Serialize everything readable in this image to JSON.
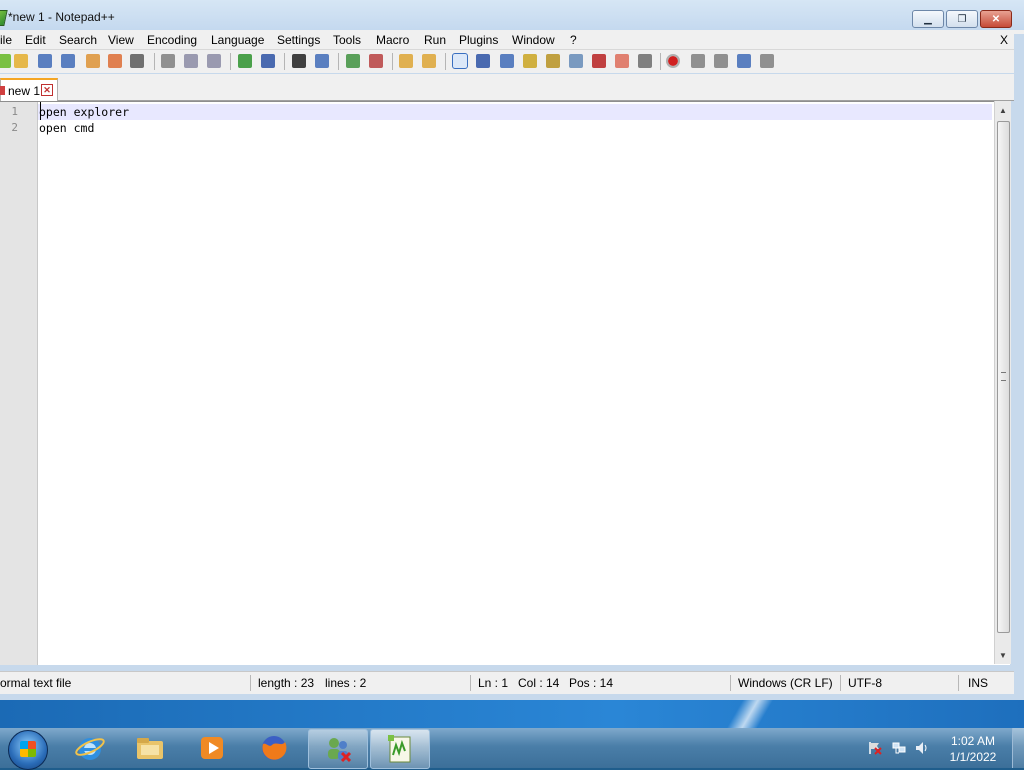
{
  "window": {
    "title": "*new 1 - Notepad++",
    "minimize_glyph": "▁",
    "maximize_glyph": "❐",
    "close_glyph": "✕"
  },
  "menubar": {
    "items": [
      "ile",
      "Edit",
      "Search",
      "View",
      "Encoding",
      "Language",
      "Settings",
      "Tools",
      "Macro",
      "Run",
      "Plugins",
      "Window",
      "?"
    ],
    "close_doc": "X"
  },
  "toolbar": {
    "icons": [
      "new-file-icon",
      "open-file-icon",
      "save-icon",
      "save-all-icon",
      "close-icon",
      "close-all-icon",
      "print-icon",
      "cut-icon",
      "copy-icon",
      "paste-icon",
      "undo-icon",
      "redo-icon",
      "find-icon",
      "replace-icon",
      "zoom-in-icon",
      "zoom-out-icon",
      "sync-v-icon",
      "sync-h-icon",
      "word-wrap-icon",
      "show-all-chars-icon",
      "indent-guide-icon",
      "udl-icon",
      "doc-map-icon",
      "doc-list-icon",
      "function-list-icon",
      "folder-workspace-icon",
      "monitoring-icon",
      "record-macro-icon",
      "stop-record-icon",
      "playback-icon",
      "run-macro-multiple-icon",
      "save-macro-icon"
    ]
  },
  "tabs": [
    {
      "label": "new 1",
      "close_glyph": "✕"
    }
  ],
  "editor": {
    "lines": [
      {
        "number": "1",
        "text": "open explorer"
      },
      {
        "number": "2",
        "text": "open cmd"
      }
    ]
  },
  "statusbar": {
    "file_type": "ormal text file",
    "length": "length : 23",
    "lines": "lines : 2",
    "ln": "Ln : 1",
    "col": "Col : 14",
    "pos": "Pos : 14",
    "eol": "Windows (CR LF)",
    "encoding": "UTF-8",
    "mode": "INS"
  },
  "taskbar": {
    "clock_time": "1:02 AM",
    "clock_date": "1/1/2022"
  }
}
